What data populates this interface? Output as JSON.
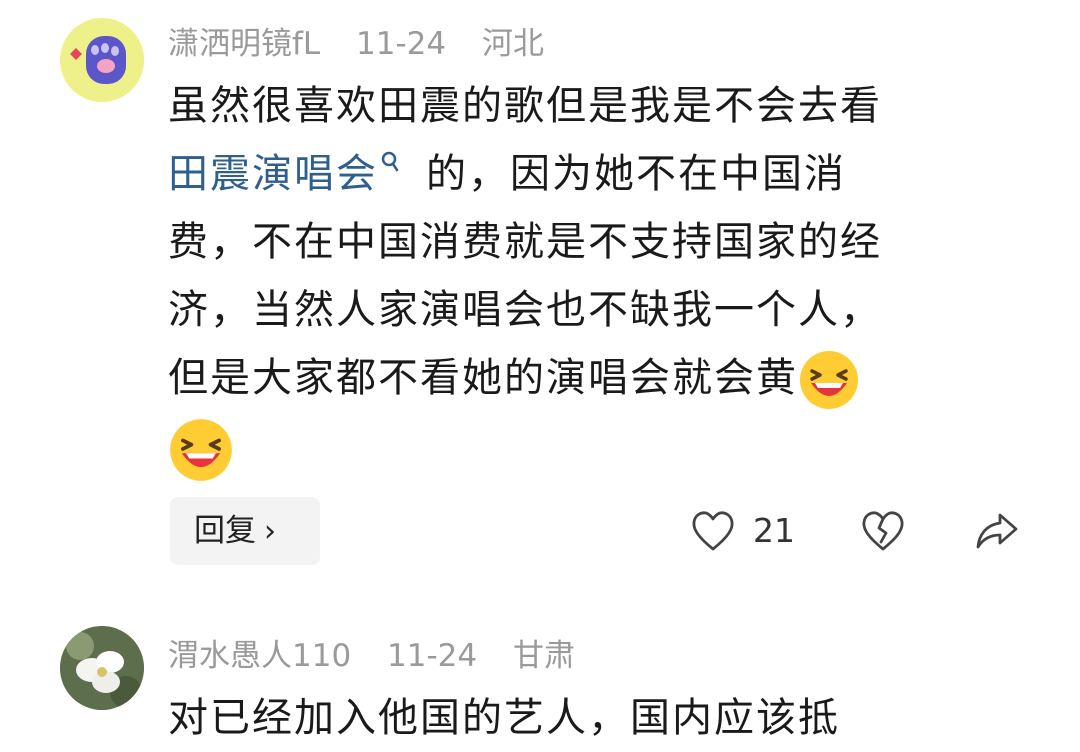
{
  "comments": [
    {
      "username": "潇洒明镜fL",
      "date": "11-24",
      "location": "河北",
      "text_line1": "虽然很喜欢田震的歌但是我是不会去看",
      "link_text": "田震演唱会",
      "text_after_link": "的，因为她不在中国消",
      "text_line3": "费，不在中国消费就是不支持国家的经",
      "text_line4": "济，当然人家演唱会也不缺我一个人，",
      "text_line5": "但是大家都不看她的演唱会就会黄",
      "reply_label": "回复",
      "like_count": "21"
    },
    {
      "username": "渭水愚人110",
      "date": "11-24",
      "location": "甘肃",
      "text_line1": "对已经加入他国的艺人，国内应该抵"
    }
  ],
  "icons": {
    "search": "search-icon",
    "laugh": "laughing-emoji",
    "like": "heart-icon",
    "dislike": "broken-heart-icon",
    "share": "share-icon",
    "chevron": "chevron-right-icon"
  },
  "colors": {
    "link": "#2f5f8f",
    "meta": "#9a9a9a",
    "reply_bg": "#f3f3f3"
  }
}
